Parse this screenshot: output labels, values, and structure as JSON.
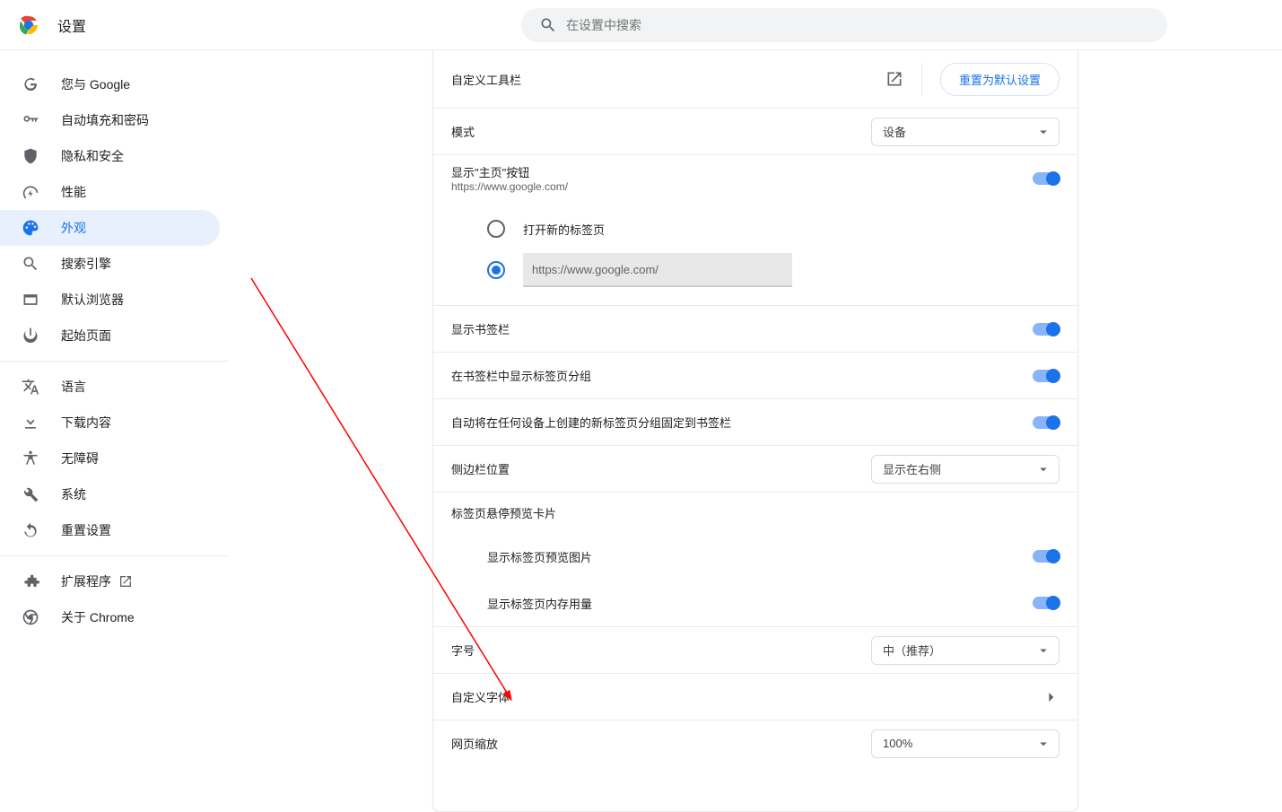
{
  "header": {
    "title": "设置",
    "search_placeholder": "在设置中搜索"
  },
  "sidebar": {
    "items": [
      {
        "label": "您与 Google"
      },
      {
        "label": "自动填充和密码"
      },
      {
        "label": "隐私和安全"
      },
      {
        "label": "性能"
      },
      {
        "label": "外观"
      },
      {
        "label": "搜索引擎"
      },
      {
        "label": "默认浏览器"
      },
      {
        "label": "起始页面"
      }
    ],
    "advanced": [
      {
        "label": "语言"
      },
      {
        "label": "下载内容"
      },
      {
        "label": "无障碍"
      },
      {
        "label": "系统"
      },
      {
        "label": "重置设置"
      }
    ],
    "footer": [
      {
        "label": "扩展程序"
      },
      {
        "label": "关于 Chrome"
      }
    ]
  },
  "main": {
    "customize_toolbar": "自定义工具栏",
    "reset_default": "重置为默认设置",
    "mode_label": "模式",
    "mode_value": "设备",
    "show_home_label": "显示\"主页\"按钮",
    "show_home_sub": "https://www.google.com/",
    "radio_new_tab": "打开新的标签页",
    "home_url": "https://www.google.com/",
    "show_bookmarks": "显示书签栏",
    "show_tab_groups": "在书签栏中显示标签页分组",
    "pin_tab_groups": "自动将在任何设备上创建的新标签页分组固定到书签栏",
    "side_panel_label": "侧边栏位置",
    "side_panel_value": "显示在右侧",
    "hover_card_header": "标签页悬停预览卡片",
    "show_preview_image": "显示标签页预览图片",
    "show_memory": "显示标签页内存用量",
    "font_size_label": "字号",
    "font_size_value": "中（推荐）",
    "custom_fonts": "自定义字体",
    "page_zoom_label": "网页缩放",
    "page_zoom_value": "100%"
  }
}
